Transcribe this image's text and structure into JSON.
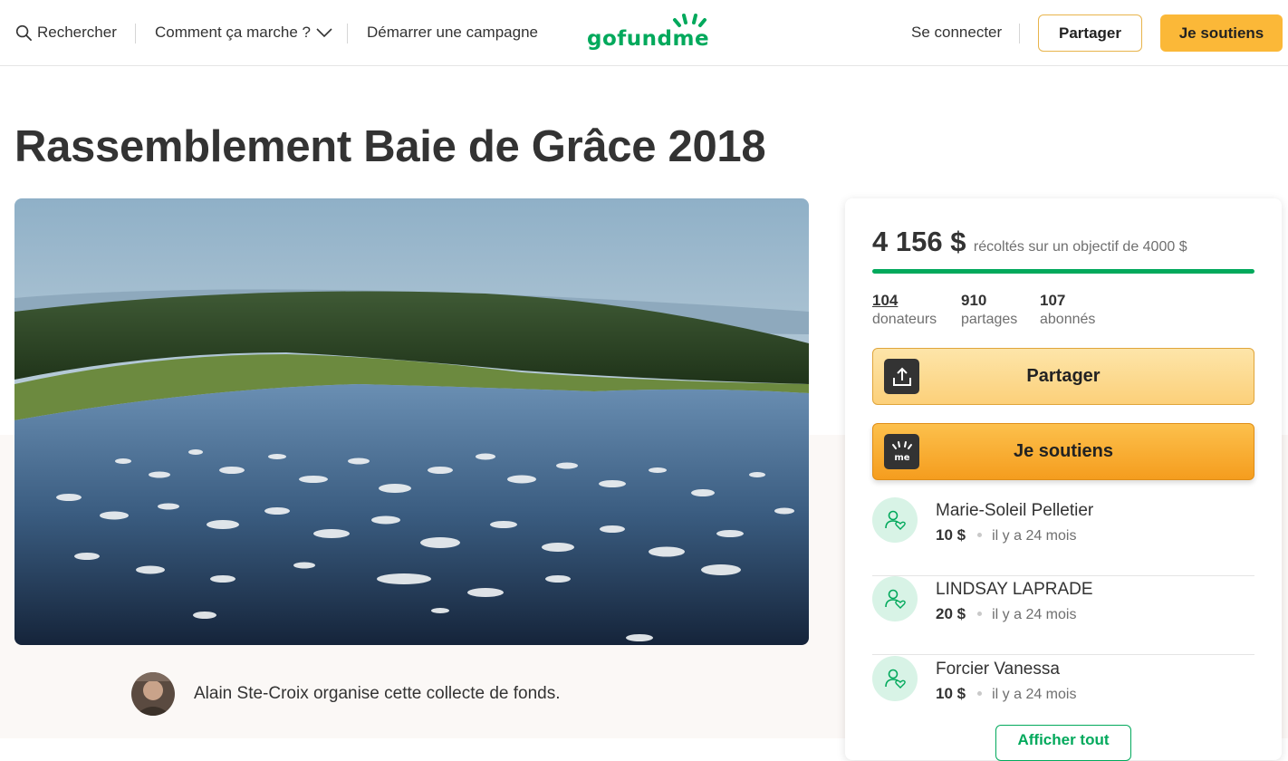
{
  "header": {
    "search_label": "Rechercher",
    "how_it_works_label": "Comment ça marche ?",
    "start_campaign_label": "Démarrer une campagne",
    "logo_text": "gofundme",
    "login_label": "Se connecter",
    "share_label": "Partager",
    "donate_label": "Je soutiens"
  },
  "campaign": {
    "title": "Rassemblement Baie de Grâce 2018",
    "organizer_text": "Alain Ste-Croix organise cette collecte de fonds."
  },
  "card": {
    "raised_amount": "4 156 $",
    "goal_text": "récoltés sur un objectif de 4000 $",
    "progress_fraction": 1.0,
    "stats": [
      {
        "number": "104",
        "label": "donateurs"
      },
      {
        "number": "910",
        "label": "partages"
      },
      {
        "number": "107",
        "label": "abonnés"
      }
    ],
    "share_button": "Partager",
    "donate_button": "Je soutiens",
    "donations": [
      {
        "name": "Marie-Soleil Pelletier",
        "amount": "10 $",
        "time": "il y a 24 mois"
      },
      {
        "name": "LINDSAY LAPRADE",
        "amount": "20 $",
        "time": "il y a 24 mois"
      },
      {
        "name": "Forcier Vanessa",
        "amount": "10 $",
        "time": "il y a 24 mois"
      }
    ],
    "show_all_button": "Afficher tout"
  },
  "colors": {
    "brand_green": "#02a95c",
    "donate_yellow": "#fbb838",
    "text": "#333333"
  },
  "icons": [
    "search-icon",
    "chevron-down-icon",
    "share-upload-icon",
    "gofundme-mark-icon",
    "donor-heart-icon"
  ]
}
